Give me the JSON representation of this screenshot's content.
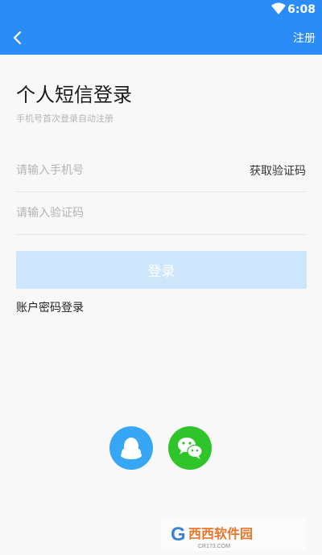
{
  "status_bar": {
    "time": "6:08"
  },
  "header": {
    "register_label": "注册"
  },
  "login": {
    "title": "个人短信登录",
    "subtitle": "手机号首次登录自动注册",
    "phone_placeholder": "请输入手机号",
    "get_code_label": "获取验证码",
    "code_placeholder": "请输入验证码",
    "login_button": "登录",
    "password_login_link": "账户密码登录"
  },
  "social": [
    {
      "name": "qq-icon",
      "color": "#37a7f5"
    },
    {
      "name": "wechat-icon",
      "color": "#2fc52a"
    }
  ],
  "watermark": {
    "text": "西西软件园",
    "url_text": "CR173.COM"
  },
  "colors": {
    "brand": "#2b8cf7",
    "login_button_disabled": "#cde6fb"
  }
}
